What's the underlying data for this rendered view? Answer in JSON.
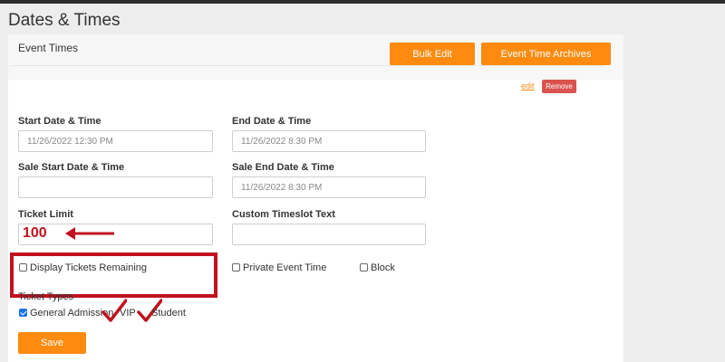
{
  "page": {
    "title": "Dates & Times"
  },
  "panel": {
    "title": "Event Times",
    "bulk_edit_label": "Bulk Edit",
    "archives_label": "Event Time Archives"
  },
  "row_actions": {
    "edit_label": "edit",
    "remove_label": "Remove"
  },
  "fields": {
    "start": {
      "label": "Start Date & Time",
      "placeholder": "11/26/2022 12:30 PM"
    },
    "end": {
      "label": "End Date & Time",
      "placeholder": "11/26/2022 8:30 PM"
    },
    "sale_start": {
      "label": "Sale Start Date & Time",
      "placeholder": ""
    },
    "sale_end": {
      "label": "Sale End Date & Time",
      "placeholder": "11/26/2022 8:30 PM"
    },
    "ticket_limit": {
      "label": "Ticket Limit",
      "value": "100"
    },
    "custom_timeslot": {
      "label": "Custom Timeslot Text",
      "placeholder": ""
    }
  },
  "options": {
    "display_remaining": {
      "label": "Display Tickets Remaining",
      "checked": false
    },
    "private_event": {
      "label": "Private Event Time",
      "checked": false
    },
    "block": {
      "label": "Block",
      "checked": false
    }
  },
  "ticket_types": {
    "heading": "Ticket Types",
    "items": [
      {
        "label": "General Admission",
        "checked": true
      },
      {
        "label": "VIP",
        "checked": true
      },
      {
        "label": "Student",
        "checked": true
      }
    ]
  },
  "save_label": "Save",
  "colors": {
    "accent": "#fc8b10",
    "danger": "#d9534f",
    "annotation": "#c1121f",
    "checkbox": "#1a73e8"
  }
}
